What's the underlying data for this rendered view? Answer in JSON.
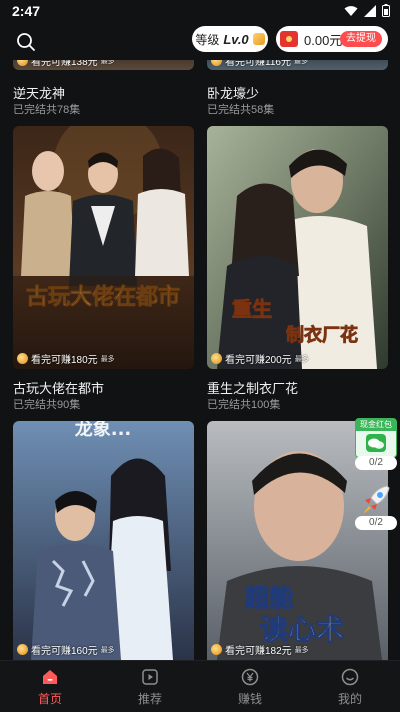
{
  "status": {
    "time": "2:47"
  },
  "top_bar": {
    "level_label": "等级",
    "level_value": "Lv.0",
    "balance": "0.00元",
    "withdraw_label": "去提现"
  },
  "cards": [
    {
      "title": "逆天龙神",
      "episodes": "已完结共78集",
      "earn": "看完可赚138元",
      "earn_more": "最多"
    },
    {
      "title": "卧龙壕少",
      "episodes": "已完结共58集",
      "earn": "看完可赚116元",
      "earn_more": "最多"
    },
    {
      "title": "古玩大佬在都市",
      "episodes": "已完结共90集",
      "earn": "看完可赚180元",
      "earn_more": "最多",
      "poster_text": "古玩大佬在都市"
    },
    {
      "title": "重生之制衣厂花",
      "episodes": "已完结共100集",
      "earn": "看完可赚200元",
      "earn_more": "最多",
      "poster_text_1": "重生",
      "poster_text_2": "制衣厂花"
    },
    {
      "title": "",
      "episodes": "",
      "earn": "看完可赚160元",
      "earn_more": "最多",
      "poster_text": "龙象..."
    },
    {
      "title": "",
      "episodes": "",
      "earn": "看完可赚182元",
      "earn_more": "最多",
      "poster_text_1": "超能",
      "poster_text_2": "读心术"
    }
  ],
  "float_widgets": {
    "wechat_redpack": {
      "label": "现金红包",
      "count": "0/2"
    },
    "rocket": {
      "count": "0/2"
    }
  },
  "bottom_nav": [
    {
      "label": "首页",
      "icon": "home-icon",
      "active": true
    },
    {
      "label": "推荐",
      "icon": "play-icon",
      "active": false
    },
    {
      "label": "赚钱",
      "icon": "yuan-icon",
      "active": false
    },
    {
      "label": "我的",
      "icon": "smile-icon",
      "active": false
    }
  ],
  "colors": {
    "accent": "#ff5a5a",
    "background": "#111214"
  }
}
